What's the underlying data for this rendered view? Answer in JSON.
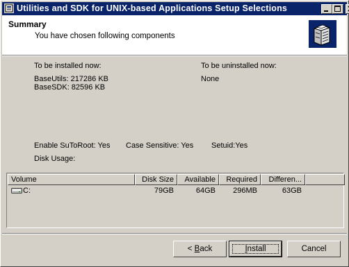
{
  "window": {
    "title": "Utilities and SDK for UNIX-based Applications Setup Selections"
  },
  "header": {
    "title": "Summary",
    "subtitle": "You have chosen following components"
  },
  "install": {
    "heading": "To be installed now:",
    "items": [
      "BaseUtils:  217286 KB",
      "BaseSDK:  82596 KB"
    ]
  },
  "uninstall": {
    "heading": "To be uninstalled now:",
    "value": "None"
  },
  "options": {
    "enable_sutoroot": "Enable SuToRoot: Yes",
    "case_sensitive": "Case Sensitive: Yes",
    "setuid": "Setuid:Yes",
    "disk_usage_label": "Disk Usage:"
  },
  "disk_table": {
    "columns": [
      "Volume",
      "Disk Size",
      "Available",
      "Required",
      "Differen..."
    ],
    "rows": [
      {
        "volume": "C:",
        "disk_size": "79GB",
        "available": "64GB",
        "required": "296MB",
        "difference": "63GB"
      }
    ]
  },
  "buttons": {
    "back_prefix": "< ",
    "back_mnemonic": "B",
    "back_rest": "ack",
    "install_mnemonic": "I",
    "install_rest": "nstall",
    "cancel": "Cancel"
  },
  "icons": {
    "app": "setup-app-icon",
    "header_logo": "servers-icon",
    "drive": "hard-drive-icon"
  },
  "colors": {
    "titlebar": "#0a246a",
    "face": "#d4d0c8",
    "header_bg": "#ffffff",
    "logo_bg": "#0a246a"
  }
}
